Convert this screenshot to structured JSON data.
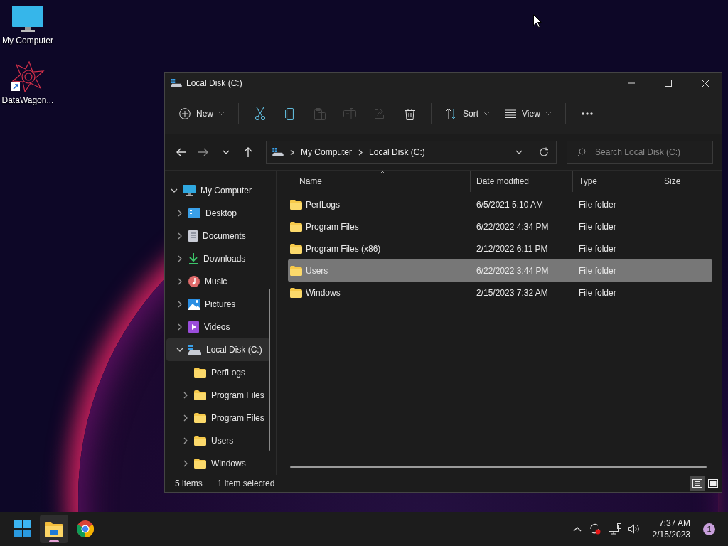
{
  "desktop_icons": [
    {
      "kind": "monitor",
      "label": "My Computer"
    },
    {
      "kind": "shortcut",
      "label": "DataWagon..."
    }
  ],
  "window": {
    "title": "Local Disk (C:)"
  },
  "toolbar": [
    {
      "kind": "new",
      "label": "New",
      "disabled": false
    },
    {
      "kind": "cut",
      "disabled": false
    },
    {
      "kind": "copy",
      "disabled": false
    },
    {
      "kind": "paste",
      "disabled": true
    },
    {
      "kind": "rename",
      "disabled": true
    },
    {
      "kind": "share",
      "disabled": true
    },
    {
      "kind": "delete",
      "disabled": false
    },
    {
      "kind": "sort",
      "label": "Sort",
      "disabled": false
    },
    {
      "kind": "view",
      "label": "View",
      "disabled": false
    },
    {
      "kind": "more",
      "disabled": false
    }
  ],
  "navigation": [
    {
      "kind": "back",
      "disabled": false
    },
    {
      "kind": "forward",
      "disabled": true
    },
    {
      "kind": "recent",
      "disabled": false
    },
    {
      "kind": "up",
      "disabled": false
    }
  ],
  "address_bar": {
    "breadcrumbs": [
      "My Computer",
      "Local Disk (C:)"
    ]
  },
  "search": {
    "placeholder": "Search Local Disk (C:)"
  },
  "sidebar": {
    "items": [
      {
        "label": "My Computer",
        "kind": "computer",
        "expanded": true,
        "selected": false,
        "children": [
          {
            "label": "Desktop",
            "kind": "desktop",
            "expanded": false,
            "selected": false,
            "has_children": true
          },
          {
            "label": "Documents",
            "kind": "documents",
            "expanded": false,
            "selected": false,
            "has_children": true
          },
          {
            "label": "Downloads",
            "kind": "downloads",
            "expanded": false,
            "selected": false,
            "has_children": true
          },
          {
            "label": "Music",
            "kind": "music",
            "expanded": false,
            "selected": false,
            "has_children": true
          },
          {
            "label": "Pictures",
            "kind": "pictures",
            "expanded": false,
            "selected": false,
            "has_children": true
          },
          {
            "label": "Videos",
            "kind": "videos",
            "expanded": false,
            "selected": false,
            "has_children": true
          },
          {
            "label": "Local Disk (C:)",
            "kind": "drive",
            "expanded": true,
            "selected": true,
            "has_children": true,
            "children": [
              {
                "label": "PerfLogs",
                "kind": "folder",
                "expanded": false,
                "selected": false,
                "has_children": false
              },
              {
                "label": "Program Files",
                "kind": "folder",
                "expanded": false,
                "selected": false,
                "has_children": true
              },
              {
                "label": "Program Files",
                "kind": "folder",
                "expanded": false,
                "selected": false,
                "has_children": true
              },
              {
                "label": "Users",
                "kind": "folder",
                "expanded": false,
                "selected": false,
                "has_children": true
              },
              {
                "label": "Windows",
                "kind": "folder",
                "expanded": false,
                "selected": false,
                "has_children": true
              }
            ]
          }
        ]
      }
    ]
  },
  "table": {
    "columns": [
      "Name",
      "Date modified",
      "Type",
      "Size"
    ],
    "rows": [
      {
        "name": "PerfLogs",
        "date_modified": "6/5/2021 5:10 AM",
        "type": "File folder",
        "selected": false
      },
      {
        "name": "Program Files",
        "date_modified": "6/22/2022 4:34 PM",
        "type": "File folder",
        "selected": false
      },
      {
        "name": "Program Files (x86)",
        "date_modified": "2/12/2022 6:11 PM",
        "type": "File folder",
        "selected": false
      },
      {
        "name": "Users",
        "date_modified": "6/22/2022 3:44 PM",
        "type": "File folder",
        "selected": true
      },
      {
        "name": "Windows",
        "date_modified": "2/15/2023 7:32 AM",
        "type": "File folder",
        "selected": false
      }
    ]
  },
  "status_bar": {
    "item_count": "5 items",
    "selection": "1 item selected"
  },
  "view_modes": [
    {
      "kind": "details",
      "selected": true
    },
    {
      "kind": "tiles",
      "selected": false
    }
  ],
  "taskbar": {
    "apps": [
      {
        "kind": "start",
        "active": false
      },
      {
        "kind": "explorer",
        "active": true
      },
      {
        "kind": "browser",
        "active": false
      }
    ],
    "tray": {
      "time": "7:37 AM",
      "date": "2/15/2023",
      "notifications": "1"
    }
  }
}
